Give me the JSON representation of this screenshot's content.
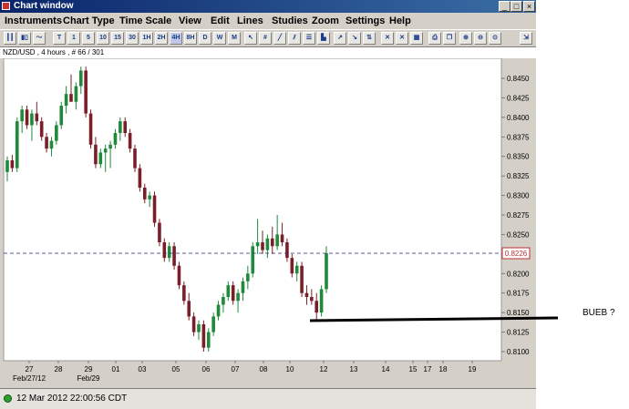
{
  "window": {
    "title": "Chart window",
    "app_icon": "chart-app-icon"
  },
  "menu": [
    "Instruments",
    "Chart Type",
    "Time Scale",
    "View",
    "Edit",
    "Lines",
    "Studies",
    "Zoom",
    "Settings",
    "Help"
  ],
  "toolbar": {
    "timeframes": [
      "T",
      "1",
      "5",
      "10",
      "15",
      "30",
      "1H",
      "2H",
      "4H",
      "8H",
      "D",
      "W",
      "M"
    ],
    "active_timeframe": "4H"
  },
  "symbol_info": "NZD/USD , 4 hours , # 66 / 301",
  "status": {
    "datetime": "12 Mar 2012 22:00:56 CDT",
    "color": "#2ca02c"
  },
  "annotation": {
    "text": "BUEB ?"
  },
  "chart_data": {
    "type": "candlestick",
    "title": "",
    "ylim": [
      0.809,
      0.848
    ],
    "y_ticks": [
      "0.8450",
      "0.8425",
      "0.8400",
      "0.8375",
      "0.8350",
      "0.8325",
      "0.8300",
      "0.8275",
      "0.8250",
      "0.8225",
      "0.8200",
      "0.8175",
      "0.8150",
      "0.8125",
      "0.8100"
    ],
    "x_ticks": [
      "27",
      "28",
      "29",
      "01",
      "03",
      "05",
      "06",
      "07",
      "08",
      "10",
      "12",
      "13",
      "14",
      "15",
      "17",
      "18",
      "19"
    ],
    "x_sub_labels": [
      "Feb/27/12",
      "Feb/29"
    ],
    "current_price": "0.8226",
    "current_price_value": 0.8226,
    "bull_color": "#1f8a3a",
    "bear_color": "#7a1f2a",
    "support_line_level": 0.8142,
    "candles": [
      [
        0.833,
        0.835,
        0.8318,
        0.8345
      ],
      [
        0.8345,
        0.8352,
        0.833,
        0.8335
      ],
      [
        0.8335,
        0.84,
        0.833,
        0.8395
      ],
      [
        0.8395,
        0.8415,
        0.838,
        0.841
      ],
      [
        0.841,
        0.8415,
        0.8385,
        0.839
      ],
      [
        0.839,
        0.841,
        0.837,
        0.8405
      ],
      [
        0.8405,
        0.842,
        0.839,
        0.8395
      ],
      [
        0.8395,
        0.84,
        0.837,
        0.8375
      ],
      [
        0.8375,
        0.838,
        0.8355,
        0.836
      ],
      [
        0.836,
        0.8375,
        0.835,
        0.837
      ],
      [
        0.837,
        0.8395,
        0.8365,
        0.839
      ],
      [
        0.839,
        0.842,
        0.8385,
        0.8415
      ],
      [
        0.8415,
        0.844,
        0.8405,
        0.843
      ],
      [
        0.843,
        0.8455,
        0.842,
        0.842
      ],
      [
        0.842,
        0.8445,
        0.841,
        0.844
      ],
      [
        0.844,
        0.8465,
        0.843,
        0.846
      ],
      [
        0.846,
        0.8465,
        0.84,
        0.8405
      ],
      [
        0.8405,
        0.841,
        0.836,
        0.8365
      ],
      [
        0.8365,
        0.8375,
        0.8335,
        0.834
      ],
      [
        0.834,
        0.836,
        0.8335,
        0.8355
      ],
      [
        0.8355,
        0.8365,
        0.833,
        0.836
      ],
      [
        0.836,
        0.837,
        0.8335,
        0.8365
      ],
      [
        0.8365,
        0.8385,
        0.836,
        0.838
      ],
      [
        0.838,
        0.84,
        0.837,
        0.8395
      ],
      [
        0.8395,
        0.84,
        0.8375,
        0.838
      ],
      [
        0.838,
        0.8385,
        0.8355,
        0.836
      ],
      [
        0.836,
        0.8365,
        0.833,
        0.8335
      ],
      [
        0.8335,
        0.834,
        0.8305,
        0.831
      ],
      [
        0.831,
        0.8315,
        0.829,
        0.8295
      ],
      [
        0.8295,
        0.8305,
        0.8285,
        0.83
      ],
      [
        0.83,
        0.8305,
        0.826,
        0.8265
      ],
      [
        0.8265,
        0.827,
        0.8235,
        0.824
      ],
      [
        0.824,
        0.8245,
        0.8215,
        0.822
      ],
      [
        0.822,
        0.824,
        0.8215,
        0.8235
      ],
      [
        0.8235,
        0.824,
        0.8205,
        0.821
      ],
      [
        0.821,
        0.8215,
        0.818,
        0.8185
      ],
      [
        0.8185,
        0.819,
        0.816,
        0.8165
      ],
      [
        0.8165,
        0.8175,
        0.814,
        0.8145
      ],
      [
        0.8145,
        0.815,
        0.812,
        0.8125
      ],
      [
        0.8125,
        0.814,
        0.8115,
        0.8135
      ],
      [
        0.8135,
        0.814,
        0.81,
        0.8105
      ],
      [
        0.8105,
        0.813,
        0.81,
        0.8125
      ],
      [
        0.8125,
        0.815,
        0.812,
        0.8145
      ],
      [
        0.8145,
        0.8165,
        0.814,
        0.816
      ],
      [
        0.816,
        0.8175,
        0.815,
        0.817
      ],
      [
        0.817,
        0.819,
        0.8165,
        0.8185
      ],
      [
        0.8185,
        0.819,
        0.816,
        0.8165
      ],
      [
        0.8165,
        0.818,
        0.815,
        0.8175
      ],
      [
        0.8175,
        0.8195,
        0.8165,
        0.819
      ],
      [
        0.819,
        0.821,
        0.818,
        0.82
      ],
      [
        0.82,
        0.824,
        0.8195,
        0.8235
      ],
      [
        0.8235,
        0.827,
        0.8225,
        0.824
      ],
      [
        0.824,
        0.8255,
        0.8225,
        0.823
      ],
      [
        0.823,
        0.825,
        0.822,
        0.8245
      ],
      [
        0.8245,
        0.826,
        0.8225,
        0.8235
      ],
      [
        0.8235,
        0.8275,
        0.823,
        0.825
      ],
      [
        0.825,
        0.8265,
        0.8235,
        0.824
      ],
      [
        0.824,
        0.8245,
        0.8215,
        0.822
      ],
      [
        0.822,
        0.8225,
        0.8195,
        0.82
      ],
      [
        0.82,
        0.8215,
        0.819,
        0.821
      ],
      [
        0.821,
        0.8215,
        0.817,
        0.8175
      ],
      [
        0.8175,
        0.8185,
        0.816,
        0.817
      ],
      [
        0.817,
        0.818,
        0.816,
        0.8165
      ],
      [
        0.8165,
        0.8175,
        0.814,
        0.815
      ],
      [
        0.815,
        0.8185,
        0.8145,
        0.818
      ],
      [
        0.818,
        0.8235,
        0.8175,
        0.8226
      ]
    ]
  }
}
